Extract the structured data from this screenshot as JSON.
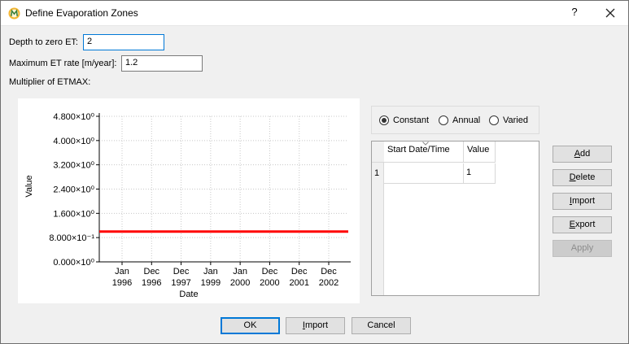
{
  "window": {
    "title": "Define Evaporation Zones",
    "help_label": "?"
  },
  "form": {
    "depth_label": "Depth to zero ET:",
    "depth_value": "2",
    "max_et_label": "Maximum ET rate [m/year]:",
    "max_et_value": "1.2",
    "multiplier_label": "Multiplier of ETMAX:"
  },
  "chart_data": {
    "type": "line",
    "xlabel": "Date",
    "ylabel": "Value",
    "ylim": [
      0,
      4.8
    ],
    "y_ticks": [
      "0.000×10⁰",
      "8.000×10⁻¹",
      "1.600×10⁰",
      "2.400×10⁰",
      "3.200×10⁰",
      "4.000×10⁰",
      "4.800×10⁰"
    ],
    "x_ticks": [
      [
        "Jan",
        "1996"
      ],
      [
        "Dec",
        "1996"
      ],
      [
        "Dec",
        "1997"
      ],
      [
        "Jan",
        "1999"
      ],
      [
        "Jan",
        "2000"
      ],
      [
        "Dec",
        "2000"
      ],
      [
        "Dec",
        "2001"
      ],
      [
        "Dec",
        "2002"
      ]
    ],
    "grid": true,
    "series": [
      {
        "values": [
          1,
          1
        ],
        "color": "#ff0000"
      }
    ]
  },
  "mode": {
    "options": [
      "Constant",
      "Annual",
      "Varied"
    ],
    "selected": "Constant"
  },
  "table": {
    "columns": [
      "Start Date/Time",
      "Value"
    ],
    "rows": [
      {
        "num": "1",
        "start": "",
        "value": "1"
      }
    ]
  },
  "side_buttons": {
    "add": "Add",
    "delete": "Delete",
    "import": "Import",
    "export": "Export",
    "apply": "Apply"
  },
  "footer": {
    "ok": "OK",
    "import": "Import",
    "cancel": "Cancel"
  },
  "colors": {
    "accent": "#0078d7",
    "series": "#ff0000"
  }
}
